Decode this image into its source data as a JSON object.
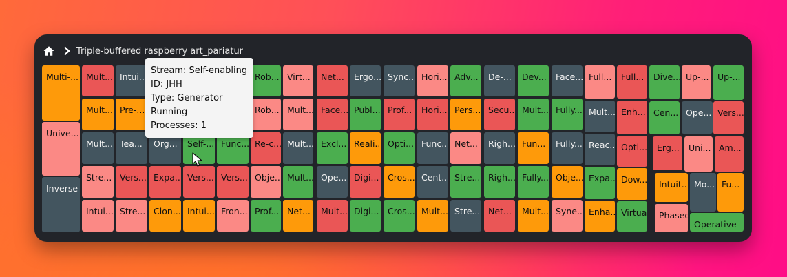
{
  "breadcrumb": {
    "title": "Triple-buffered raspberry art_pariatur"
  },
  "colors": {
    "red": "#ea5656",
    "pink": "#fb8985",
    "green": "#4bae4f",
    "slate": "#43555f",
    "orange": "#fe9a0a"
  },
  "tooltip": {
    "stream": "Stream: Self-enabling",
    "id": "ID: JHH",
    "type": "Type: Generator",
    "status": "Running",
    "processes": "Processes: 1"
  },
  "tiles": [
    {
      "label": "Multi-...",
      "color": "orange"
    },
    {
      "label": "Unive...",
      "color": "pink"
    },
    {
      "label": "Inverse",
      "color": "slate"
    },
    {
      "label": "Mult...",
      "color": "red"
    },
    {
      "label": "Mult...",
      "color": "orange"
    },
    {
      "label": "Mult...",
      "color": "slate"
    },
    {
      "label": "Stre...",
      "color": "pink"
    },
    {
      "label": "Intui...",
      "color": "pink"
    },
    {
      "label": "Intui...",
      "color": "slate"
    },
    {
      "label": "Pre-...",
      "color": "orange"
    },
    {
      "label": "Tea...",
      "color": "slate"
    },
    {
      "label": "Vers...",
      "color": "red"
    },
    {
      "label": "Stre...",
      "color": "pink"
    },
    {
      "label": "Org...",
      "color": "slate"
    },
    {
      "label": "Expa...",
      "color": "red"
    },
    {
      "label": "Clon...",
      "color": "orange"
    },
    {
      "label": "Self-...",
      "color": "green"
    },
    {
      "label": "Vers...",
      "color": "red"
    },
    {
      "label": "Intui...",
      "color": "orange"
    },
    {
      "label": "Func...",
      "color": "green"
    },
    {
      "label": "Vers...",
      "color": "red"
    },
    {
      "label": "Fron...",
      "color": "pink"
    },
    {
      "label": "Rob...",
      "color": "green"
    },
    {
      "label": "Rob...",
      "color": "pink"
    },
    {
      "label": "Re-c...",
      "color": "red"
    },
    {
      "label": "Obje...",
      "color": "pink"
    },
    {
      "label": "Prof...",
      "color": "green"
    },
    {
      "label": "Virt...",
      "color": "pink"
    },
    {
      "label": "Mult...",
      "color": "pink"
    },
    {
      "label": "Mult...",
      "color": "slate"
    },
    {
      "label": "Mult...",
      "color": "green"
    },
    {
      "label": "Net...",
      "color": "orange"
    },
    {
      "label": "Net...",
      "color": "red"
    },
    {
      "label": "Face...",
      "color": "red"
    },
    {
      "label": "Excl...",
      "color": "green"
    },
    {
      "label": "Ope...",
      "color": "slate"
    },
    {
      "label": "Mult...",
      "color": "red"
    },
    {
      "label": "Ergo...",
      "color": "slate"
    },
    {
      "label": "Publ...",
      "color": "green"
    },
    {
      "label": "Reali...",
      "color": "orange"
    },
    {
      "label": "Digi...",
      "color": "red"
    },
    {
      "label": "Digi...",
      "color": "green"
    },
    {
      "label": "Sync...",
      "color": "slate"
    },
    {
      "label": "Prof...",
      "color": "red"
    },
    {
      "label": "Opti...",
      "color": "green"
    },
    {
      "label": "Cros...",
      "color": "orange"
    },
    {
      "label": "Cros...",
      "color": "green"
    },
    {
      "label": "Hori...",
      "color": "pink"
    },
    {
      "label": "Hori...",
      "color": "red"
    },
    {
      "label": "Func...",
      "color": "slate"
    },
    {
      "label": "Cent...",
      "color": "slate"
    },
    {
      "label": "Mult...",
      "color": "orange"
    },
    {
      "label": "Adv...",
      "color": "green"
    },
    {
      "label": "Pers...",
      "color": "orange"
    },
    {
      "label": "Net...",
      "color": "pink"
    },
    {
      "label": "Stre...",
      "color": "green"
    },
    {
      "label": "Stre...",
      "color": "slate"
    },
    {
      "label": "De-...",
      "color": "slate"
    },
    {
      "label": "Secu...",
      "color": "red"
    },
    {
      "label": "Righ...",
      "color": "slate"
    },
    {
      "label": "Righ...",
      "color": "green"
    },
    {
      "label": "Net...",
      "color": "red"
    },
    {
      "label": "Dev...",
      "color": "green"
    },
    {
      "label": "Mult...",
      "color": "green"
    },
    {
      "label": "Fun...",
      "color": "orange"
    },
    {
      "label": "Fully...",
      "color": "green"
    },
    {
      "label": "Mult...",
      "color": "orange"
    },
    {
      "label": "Face...",
      "color": "slate"
    },
    {
      "label": "Fully...",
      "color": "green"
    },
    {
      "label": "Fully...",
      "color": "slate"
    },
    {
      "label": "Obje...",
      "color": "orange"
    },
    {
      "label": "Syne...",
      "color": "pink"
    },
    {
      "label": "Full...",
      "color": "pink"
    },
    {
      "label": "Mult...",
      "color": "slate"
    },
    {
      "label": "Reac...",
      "color": "slate"
    },
    {
      "label": "Expa...",
      "color": "green"
    },
    {
      "label": "Enha...",
      "color": "orange"
    },
    {
      "label": "Full...",
      "color": "red"
    },
    {
      "label": "Enh...",
      "color": "red"
    },
    {
      "label": "Opti...",
      "color": "red"
    },
    {
      "label": "Dow...",
      "color": "orange"
    },
    {
      "label": "Virtual",
      "color": "green"
    },
    {
      "label": "Dive...",
      "color": "green"
    },
    {
      "label": "Cen...",
      "color": "green"
    },
    {
      "label": "Erg...",
      "color": "red"
    },
    {
      "label": "Intuit...",
      "color": "orange"
    },
    {
      "label": "Phased",
      "color": "pink"
    },
    {
      "label": "Up-...",
      "color": "pink"
    },
    {
      "label": "Ope...",
      "color": "slate"
    },
    {
      "label": "Uni...",
      "color": "pink"
    },
    {
      "label": "Mo...",
      "color": "slate"
    },
    {
      "label": "Up-...",
      "color": "green"
    },
    {
      "label": "Vers...",
      "color": "red"
    },
    {
      "label": "Am...",
      "color": "red"
    },
    {
      "label": "Fu...",
      "color": "orange"
    },
    {
      "label": "Operative",
      "color": "green"
    }
  ]
}
